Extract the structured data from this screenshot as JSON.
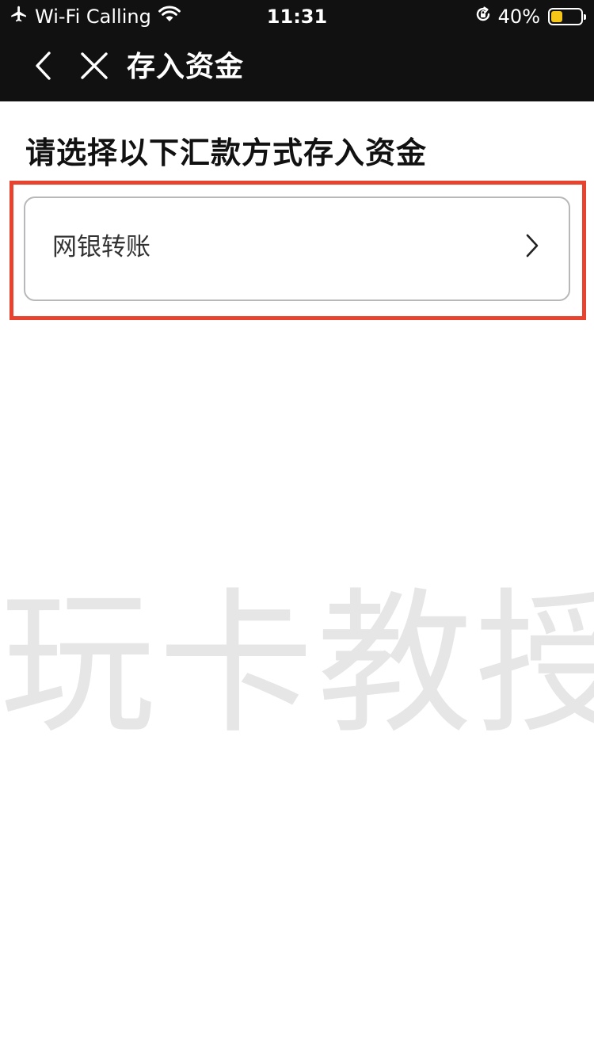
{
  "status_bar": {
    "carrier": "Wi-Fi Calling",
    "time": "11:31",
    "battery": "40%",
    "battery_level": 0.4,
    "battery_color": "#f5c518",
    "icons": [
      "airplane-icon",
      "wifi-icon",
      "rotation-lock-icon",
      "battery-icon"
    ]
  },
  "nav": {
    "title": "存入资金",
    "back_icon": "chevron-left-icon",
    "close_icon": "close-icon"
  },
  "main": {
    "heading": "请选择以下汇款方式存入资金",
    "options": [
      {
        "label": "网银转账",
        "icon": "chevron-right-icon"
      }
    ],
    "highlight_color": "#e8432e"
  },
  "watermark": {
    "text": "玩卡教授"
  }
}
